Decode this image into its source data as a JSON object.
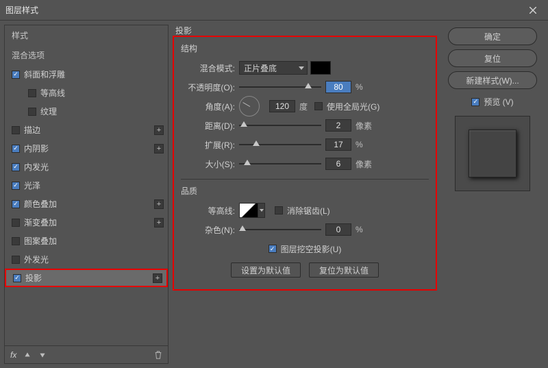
{
  "window": {
    "title": "图层样式"
  },
  "left": {
    "styles_header": "样式",
    "blend_options": "混合选项",
    "items": [
      {
        "label": "斜面和浮雕",
        "checked": true,
        "hasPlus": false,
        "sub": false
      },
      {
        "label": "等高线",
        "checked": false,
        "hasPlus": false,
        "sub": true
      },
      {
        "label": "纹理",
        "checked": false,
        "hasPlus": false,
        "sub": true
      },
      {
        "label": "描边",
        "checked": false,
        "hasPlus": true,
        "sub": false
      },
      {
        "label": "内阴影",
        "checked": true,
        "hasPlus": true,
        "sub": false
      },
      {
        "label": "内发光",
        "checked": true,
        "hasPlus": false,
        "sub": false
      },
      {
        "label": "光泽",
        "checked": true,
        "hasPlus": false,
        "sub": false
      },
      {
        "label": "颜色叠加",
        "checked": true,
        "hasPlus": true,
        "sub": false
      },
      {
        "label": "渐变叠加",
        "checked": false,
        "hasPlus": true,
        "sub": false
      },
      {
        "label": "图案叠加",
        "checked": false,
        "hasPlus": false,
        "sub": false
      },
      {
        "label": "外发光",
        "checked": false,
        "hasPlus": false,
        "sub": false
      },
      {
        "label": "投影",
        "checked": true,
        "hasPlus": true,
        "sub": false,
        "selected": true
      }
    ],
    "footer_fx": "fx"
  },
  "center": {
    "panel_title": "投影",
    "structure_title": "结构",
    "blend_mode_label": "混合模式:",
    "blend_mode_value": "正片叠底",
    "opacity_label": "不透明度(O):",
    "opacity_value": "80",
    "opacity_unit": "%",
    "angle_label": "角度(A):",
    "angle_value": "120",
    "angle_unit": "度",
    "global_light_label": "使用全局光(G)",
    "distance_label": "距离(D):",
    "distance_value": "2",
    "distance_unit": "像素",
    "spread_label": "扩展(R):",
    "spread_value": "17",
    "spread_unit": "%",
    "size_label": "大小(S):",
    "size_value": "6",
    "size_unit": "像素",
    "quality_title": "品质",
    "contour_label": "等高线:",
    "antialias_label": "消除锯齿(L)",
    "noise_label": "杂色(N):",
    "noise_value": "0",
    "noise_unit": "%",
    "knockout_label": "图层挖空投影(U)",
    "btn_default": "设置为默认值",
    "btn_reset": "复位为默认值"
  },
  "right": {
    "ok": "确定",
    "cancel": "复位",
    "new_style": "新建样式(W)...",
    "preview_label": "预览 (V)"
  }
}
